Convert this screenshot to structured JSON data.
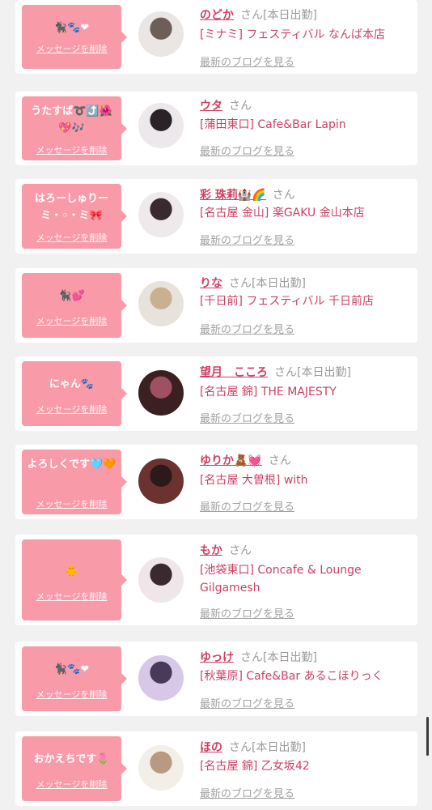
{
  "delete_label": "メッセージを削除",
  "san_label": "さん",
  "blog_label": "最新のブログを見る",
  "items": [
    {
      "message": "🐈‍⬛🐾❤",
      "name": "のどか",
      "status": "[本日出勤]",
      "shop": "[ミナミ] フェスティバル なんば本店",
      "avatar_colors": [
        "#e9e6e4",
        "#6d5f57"
      ]
    },
    {
      "message": "うたすば➰⤴️🌺💖🎶",
      "name": "ウタ",
      "status": "",
      "shop": "[蒲田東口] Cafe&Bar Lapin",
      "avatar_colors": [
        "#ece8ec",
        "#2a2226"
      ]
    },
    {
      "message": "はろーしゅりーミ・◦・ミ🎀",
      "name": "彩 珠莉🏰🌈",
      "status": "",
      "shop": "[名古屋 金山] 楽GAKU 金山本店",
      "avatar_colors": [
        "#efe9eb",
        "#3a2a30"
      ]
    },
    {
      "message": "🐈‍⬛💕",
      "name": "りな",
      "status": "[本日出勤]",
      "shop": "[千日前] フェスティバル 千日前店",
      "avatar_colors": [
        "#e8e2dc",
        "#c9b091"
      ]
    },
    {
      "message": "にゃん🐾",
      "name": "望月　こころ",
      "status": "[本日出勤]",
      "shop": "[名古屋 錦] THE MAJESTY",
      "avatar_colors": [
        "#3a2020",
        "#a05060"
      ]
    },
    {
      "message": "よろしくです🩵🧡",
      "name": "ゆりか🧸💓",
      "status": "",
      "shop": "[名古屋 大曽根] with",
      "avatar_colors": [
        "#6b3230",
        "#2c1a1a"
      ]
    },
    {
      "message": "🐥",
      "name": "もか",
      "status": "",
      "shop": "[池袋東口] Concafe & Lounge Gilgamesh",
      "avatar_colors": [
        "#f0e6ea",
        "#3a2a30"
      ]
    },
    {
      "message": "🐈‍⬛🐾❤",
      "name": "ゆっけ",
      "status": "[本日出勤]",
      "shop": "[秋葉原] Cafe&Bar あるこほりっく",
      "avatar_colors": [
        "#d8c8e8",
        "#4a3a5a"
      ]
    },
    {
      "message": "おかえちです🌷",
      "name": "ほの",
      "status": "[本日出勤]",
      "shop": "[名古屋 錦] 乙女坂42",
      "avatar_colors": [
        "#f2efe8",
        "#b89a80"
      ]
    }
  ]
}
